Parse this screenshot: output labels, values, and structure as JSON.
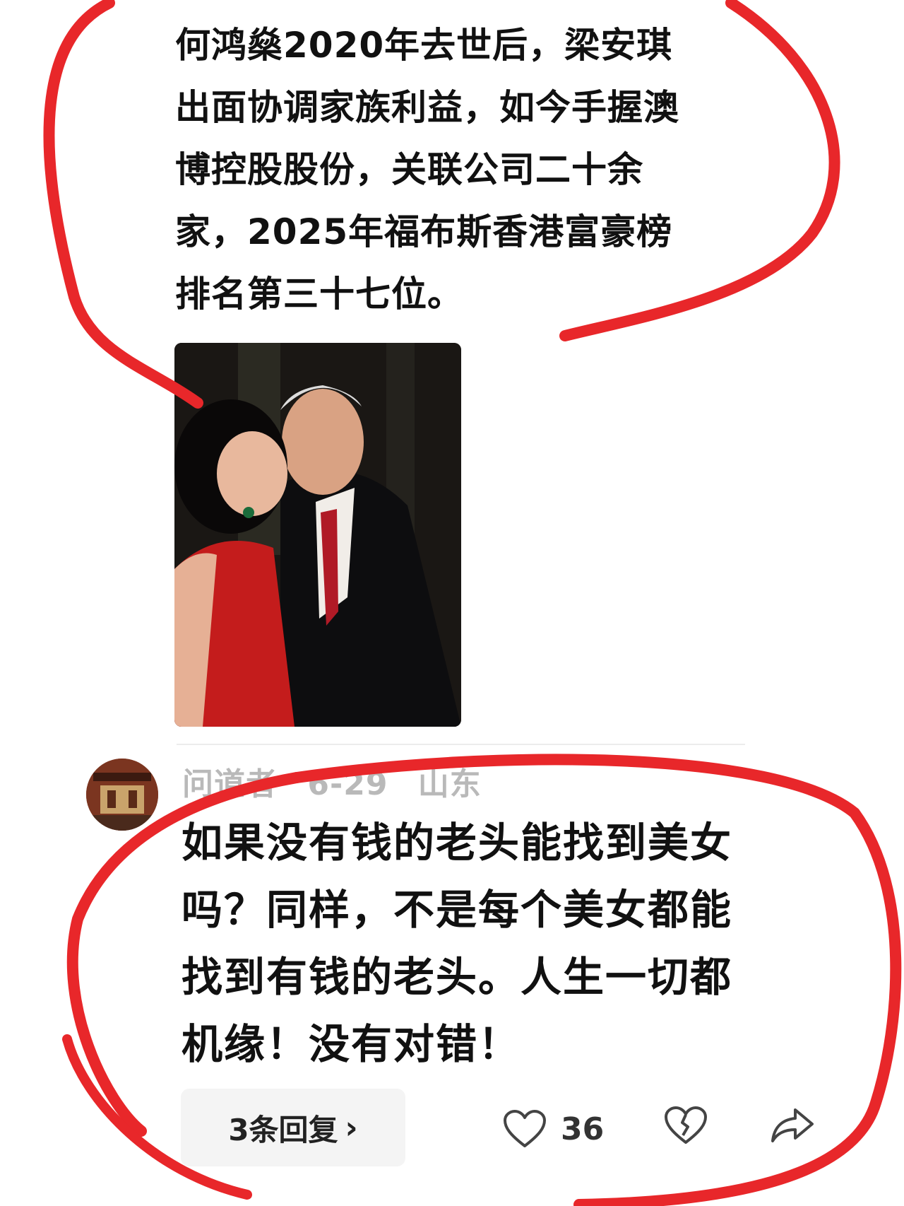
{
  "post": {
    "lines": [
      "何鸿燊2020年去世后，梁安琪",
      "出面协调家族利益，如今手握澳",
      "博控股股份，关联公司二十余",
      "家，2025年福布斯香港富豪榜",
      "排名第三十七位。"
    ]
  },
  "comment": {
    "username": "问道者",
    "date": "6-29",
    "location": "山东",
    "lines": [
      "如果没有钱的老头能找到美女",
      "吗？同样，不是每个美女都能",
      "找到有钱的老头。人生一切都",
      "机缘！没有对错！"
    ],
    "replies_label": "3条回复",
    "like_count": "36"
  },
  "icons": {
    "like": "heart-icon",
    "dislike": "broken-heart-icon",
    "share": "share-arrow-icon",
    "replies_chevron": "chevron-right-icon"
  },
  "colors": {
    "annotation_red": "#e8272a"
  }
}
